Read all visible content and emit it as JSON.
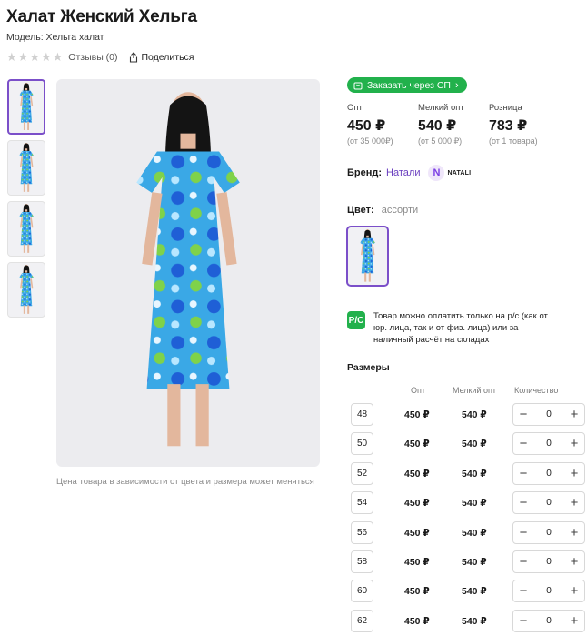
{
  "product": {
    "title": "Халат Женский Хельга",
    "model": "Модель: Хельга халат",
    "reviews": "Отзывы (0)",
    "share": "Поделиться",
    "price_note": "Цена товара в зависимости от цвета и размера может меняться"
  },
  "order": {
    "label": "Заказать через СП"
  },
  "prices": [
    {
      "label": "Опт",
      "value": "450 ₽",
      "sub": "(от 35 000₽)"
    },
    {
      "label": "Мелкий опт",
      "value": "540 ₽",
      "sub": "(от 5 000 ₽)"
    },
    {
      "label": "Розница",
      "value": "783 ₽",
      "sub": "(от 1 товара)"
    }
  ],
  "brand": {
    "label": "Бренд:",
    "name": "Натали",
    "logo_text": "NATALI",
    "logo_letter": "N"
  },
  "color": {
    "label": "Цвет:",
    "value": "ассорти"
  },
  "payment": {
    "icon_text": "Р/С",
    "text": "Товар можно оплатить только на р/с (как от юр. лица, так и от физ. лица) или за наличный расчёт на складах"
  },
  "sizes": {
    "title": "Размеры",
    "headers": {
      "opt": "Опт",
      "small_opt": "Мелкий опт",
      "qty": "Количество"
    },
    "rows": [
      {
        "size": "48",
        "opt": "450 ₽",
        "small": "540 ₽",
        "qty": "0"
      },
      {
        "size": "50",
        "opt": "450 ₽",
        "small": "540 ₽",
        "qty": "0"
      },
      {
        "size": "52",
        "opt": "450 ₽",
        "small": "540 ₽",
        "qty": "0"
      },
      {
        "size": "54",
        "opt": "450 ₽",
        "small": "540 ₽",
        "qty": "0"
      },
      {
        "size": "56",
        "opt": "450 ₽",
        "small": "540 ₽",
        "qty": "0"
      },
      {
        "size": "58",
        "opt": "450 ₽",
        "small": "540 ₽",
        "qty": "0"
      },
      {
        "size": "60",
        "opt": "450 ₽",
        "small": "540 ₽",
        "qty": "0"
      },
      {
        "size": "62",
        "opt": "450 ₽",
        "small": "540 ₽",
        "qty": "0"
      }
    ]
  },
  "colors": {
    "accent": "#7b4fc9",
    "green": "#22b14c"
  }
}
